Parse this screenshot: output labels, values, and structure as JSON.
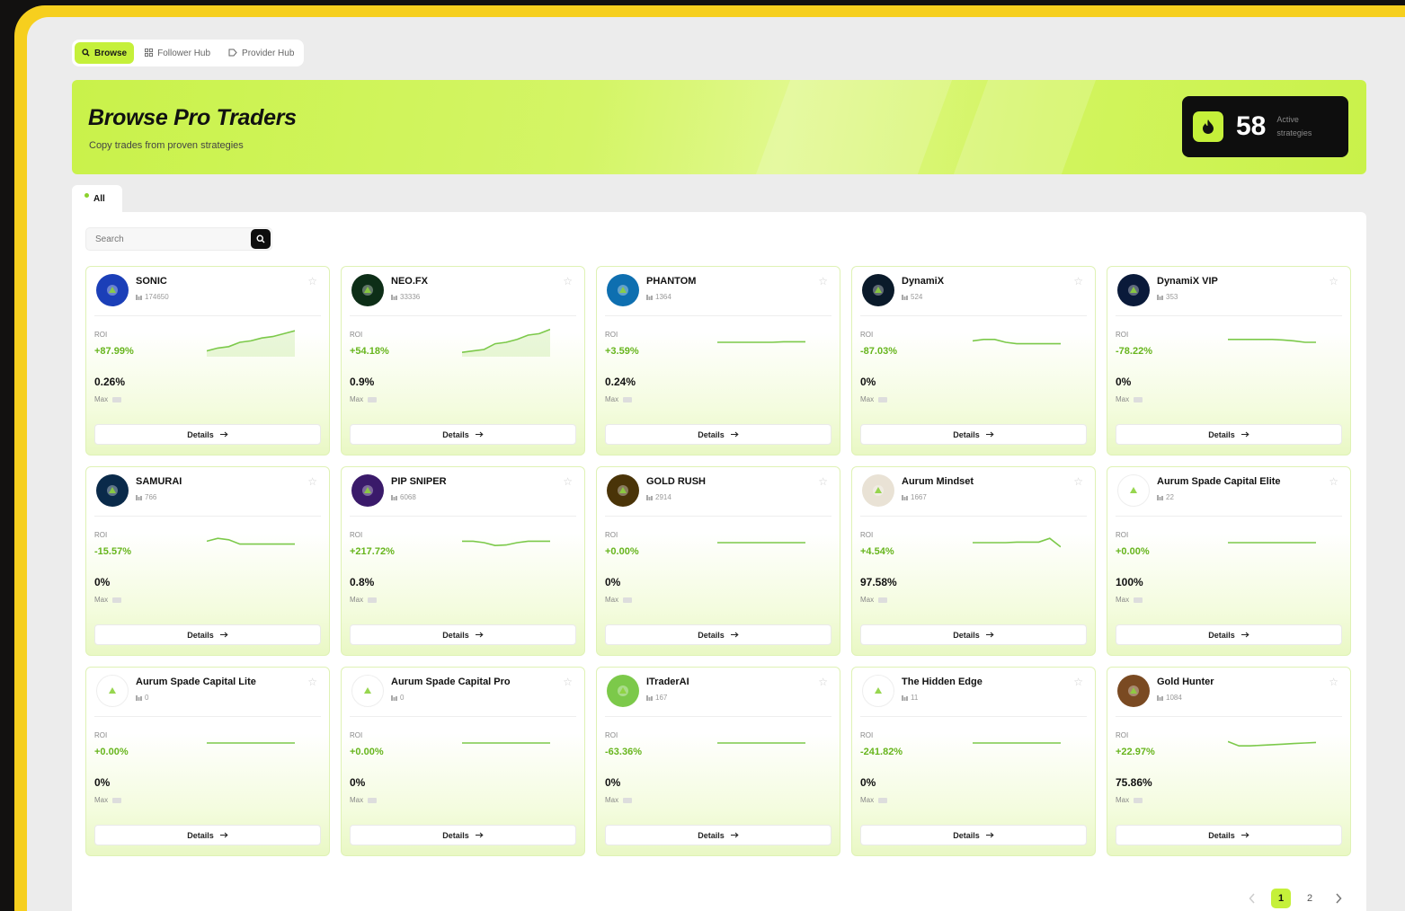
{
  "nav": {
    "tabs": [
      {
        "icon": "search-icon",
        "label": "Browse",
        "active": true
      },
      {
        "icon": "grid-icon",
        "label": "Follower Hub",
        "active": false
      },
      {
        "icon": "tag-icon",
        "label": "Provider Hub",
        "active": false
      }
    ]
  },
  "hero": {
    "title": "Browse Pro Traders",
    "subtitle": "Copy trades from proven strategies",
    "stat_value": "58",
    "stat_label": "Active strategies",
    "stat_icon": "flame-icon"
  },
  "filter": {
    "label": "All"
  },
  "search": {
    "placeholder": "Search"
  },
  "labels": {
    "roi": "ROI",
    "max": "Max",
    "details": "Details"
  },
  "traders": [
    {
      "name": "SONIC",
      "id": "174650",
      "roi": "+87.99%",
      "roi_positive": true,
      "drawdown": "0.26%",
      "avatar_color": "#1b3fb8",
      "spark": [
        0.2,
        0.3,
        0.35,
        0.5,
        0.55,
        0.65,
        0.7,
        0.8,
        0.9
      ],
      "spark_fill": true
    },
    {
      "name": "NEO.FX",
      "id": "33336",
      "roi": "+54.18%",
      "roi_positive": true,
      "drawdown": "0.9%",
      "avatar_color": "#0d2e17",
      "spark": [
        0.15,
        0.2,
        0.25,
        0.45,
        0.5,
        0.6,
        0.75,
        0.8,
        0.95
      ],
      "spark_fill": true
    },
    {
      "name": "PHANTOM",
      "id": "1364",
      "roi": "+3.59%",
      "roi_positive": true,
      "drawdown": "0.24%",
      "avatar_color": "#0e6fb0",
      "spark": [
        0.5,
        0.5,
        0.5,
        0.5,
        0.5,
        0.5,
        0.52,
        0.52,
        0.52
      ],
      "spark_fill": false
    },
    {
      "name": "DynamiX",
      "id": "524",
      "roi": "-87.03%",
      "roi_positive": false,
      "drawdown": "0%",
      "avatar_color": "#0a1a2a",
      "spark": [
        0.55,
        0.6,
        0.6,
        0.5,
        0.45,
        0.45,
        0.45,
        0.45,
        0.45
      ],
      "spark_fill": false
    },
    {
      "name": "DynamiX VIP",
      "id": "353",
      "roi": "-78.22%",
      "roi_positive": false,
      "drawdown": "0%",
      "avatar_color": "#0a1a3a",
      "spark": [
        0.6,
        0.6,
        0.6,
        0.6,
        0.6,
        0.58,
        0.55,
        0.5,
        0.5
      ],
      "spark_fill": false
    },
    {
      "name": "SAMURAI",
      "id": "766",
      "roi": "-15.57%",
      "roi_positive": false,
      "drawdown": "0%",
      "avatar_color": "#0a2a4a",
      "spark": [
        0.55,
        0.65,
        0.6,
        0.45,
        0.45,
        0.45,
        0.45,
        0.45,
        0.45
      ],
      "spark_fill": false
    },
    {
      "name": "PIP SNIPER",
      "id": "6068",
      "roi": "+217.72%",
      "roi_positive": true,
      "drawdown": "0.8%",
      "avatar_color": "#3a1a6a",
      "spark": [
        0.55,
        0.55,
        0.5,
        0.4,
        0.42,
        0.5,
        0.55,
        0.55,
        0.55
      ],
      "spark_fill": false
    },
    {
      "name": "GOLD RUSH",
      "id": "2914",
      "roi": "+0.00%",
      "roi_positive": true,
      "drawdown": "0%",
      "avatar_color": "#4a3408",
      "spark": [
        0.5,
        0.5,
        0.5,
        0.5,
        0.5,
        0.5,
        0.5,
        0.5,
        0.5
      ],
      "spark_fill": false
    },
    {
      "name": "Aurum Mindset",
      "id": "1667",
      "roi": "+4.54%",
      "roi_positive": true,
      "drawdown": "97.58%",
      "avatar_color": "#e9e2d5",
      "spark": [
        0.5,
        0.5,
        0.5,
        0.5,
        0.52,
        0.52,
        0.52,
        0.65,
        0.35
      ],
      "spark_fill": false
    },
    {
      "name": "Aurum Spade Capital Elite",
      "id": "22",
      "roi": "+0.00%",
      "roi_positive": true,
      "drawdown": "100%",
      "avatar_color": "#ffffff",
      "spark": [
        0.5,
        0.5,
        0.5,
        0.5,
        0.5,
        0.5,
        0.5,
        0.5,
        0.5
      ],
      "spark_fill": false
    },
    {
      "name": "Aurum Spade Capital Lite",
      "id": "0",
      "roi": "+0.00%",
      "roi_positive": true,
      "drawdown": "0%",
      "avatar_color": "#ffffff",
      "spark": [
        0.5,
        0.5,
        0.5,
        0.5,
        0.5,
        0.5,
        0.5,
        0.5,
        0.5
      ],
      "spark_fill": false
    },
    {
      "name": "Aurum Spade Capital Pro",
      "id": "0",
      "roi": "+0.00%",
      "roi_positive": true,
      "drawdown": "0%",
      "avatar_color": "#ffffff",
      "spark": [
        0.5,
        0.5,
        0.5,
        0.5,
        0.5,
        0.5,
        0.5,
        0.5,
        0.5
      ],
      "spark_fill": false
    },
    {
      "name": "ITraderAI",
      "id": "167",
      "roi": "-63.36%",
      "roi_positive": false,
      "drawdown": "0%",
      "avatar_color": "#7cc94a",
      "spark": [
        0.5,
        0.5,
        0.5,
        0.5,
        0.5,
        0.5,
        0.5,
        0.5,
        0.5
      ],
      "spark_fill": false
    },
    {
      "name": "The Hidden Edge",
      "id": "11",
      "roi": "-241.82%",
      "roi_positive": false,
      "drawdown": "0%",
      "avatar_color": "#ffffff",
      "spark": [
        0.5,
        0.5,
        0.5,
        0.5,
        0.5,
        0.5,
        0.5,
        0.5,
        0.5
      ],
      "spark_fill": false
    },
    {
      "name": "Gold Hunter",
      "id": "1084",
      "roi": "+22.97%",
      "roi_positive": true,
      "drawdown": "75.86%",
      "avatar_color": "#7a4a22",
      "spark": [
        0.55,
        0.4,
        0.4,
        0.42,
        0.44,
        0.46,
        0.48,
        0.5,
        0.52
      ],
      "spark_fill": false
    }
  ],
  "pagination": {
    "pages": [
      "1",
      "2"
    ],
    "current": "1"
  },
  "colors": {
    "accent": "#c5f03a",
    "positive": "#67b51d",
    "frame": "#f6cf1e"
  }
}
